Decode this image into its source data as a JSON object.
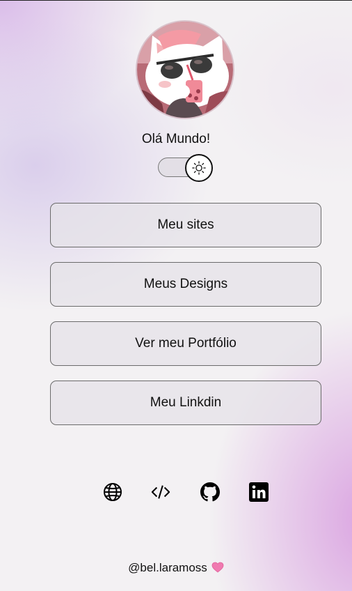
{
  "profile": {
    "avatar_icon": "cat-with-sunglasses-avatar",
    "greeting": "Olá Mundo!"
  },
  "theme_toggle": {
    "icon": "sun-icon",
    "state": "off"
  },
  "links": [
    {
      "label": "Meu sites"
    },
    {
      "label": "Meus Designs"
    },
    {
      "label": "Ver meu Portfólio"
    },
    {
      "label": "Meu Linkdin"
    }
  ],
  "social_icons": [
    "globe-icon",
    "code-icon",
    "github-icon",
    "linkedin-icon"
  ],
  "footer": {
    "handle": "@bel.laramoss",
    "heart_icon": "pink-heart-icon",
    "heart_color": "#f07ab0"
  },
  "colors": {
    "accent_pink": "#d97a8c",
    "gradient_purple": "#d6a0e0"
  }
}
